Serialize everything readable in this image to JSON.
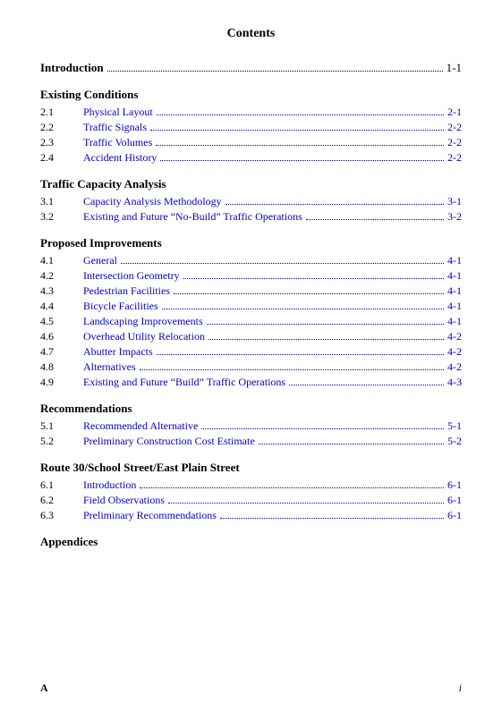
{
  "page": {
    "title": "Contents",
    "footer": {
      "left": "A",
      "right": "i"
    }
  },
  "intro": {
    "label": "Introduction",
    "page": "1-1"
  },
  "sections": [
    {
      "heading": "Existing Conditions",
      "entries": [
        {
          "number": "2.1",
          "label": "Physical Layout",
          "page": "2-1"
        },
        {
          "number": "2.2",
          "label": "Traffic Signals",
          "page": "2-2"
        },
        {
          "number": "2.3",
          "label": "Traffic Volumes",
          "page": "2-2"
        },
        {
          "number": "2.4",
          "label": "Accident History",
          "page": "2-2"
        }
      ]
    },
    {
      "heading": "Traffic Capacity Analysis",
      "entries": [
        {
          "number": "3.1",
          "label": "Capacity Analysis Methodology",
          "page": "3-1"
        },
        {
          "number": "3.2",
          "label": "Existing and Future “No-Build” Traffic Operations",
          "page": "3-2"
        }
      ]
    },
    {
      "heading": "Proposed Improvements",
      "entries": [
        {
          "number": "4.1",
          "label": "General",
          "page": "4-1"
        },
        {
          "number": "4.2",
          "label": "Intersection Geometry",
          "page": "4-1"
        },
        {
          "number": "4.3",
          "label": "Pedestrian Facilities",
          "page": "4-1"
        },
        {
          "number": "4.4",
          "label": "Bicycle Facilities",
          "page": "4-1"
        },
        {
          "number": "4.5",
          "label": "Landscaping Improvements",
          "page": "4-1"
        },
        {
          "number": "4.6",
          "label": "Overhead Utility Relocation",
          "page": "4-2"
        },
        {
          "number": "4.7",
          "label": "Abutter Impacts",
          "page": "4-2"
        },
        {
          "number": "4.8",
          "label": "Alternatives",
          "page": "4-2"
        },
        {
          "number": "4.9",
          "label": "Existing and Future “Build” Traffic Operations",
          "page": "4-3"
        }
      ]
    },
    {
      "heading": "Recommendations",
      "entries": [
        {
          "number": "5.1",
          "label": "Recommended Alternative",
          "page": "5-1"
        },
        {
          "number": "5.2",
          "label": "Preliminary Construction Cost Estimate",
          "page": "5-2"
        }
      ]
    },
    {
      "heading": "Route 30/School Street/East Plain Street",
      "entries": [
        {
          "number": "6.1",
          "label": "Introduction",
          "page": "6-1"
        },
        {
          "number": "6.2",
          "label": "Field Observations",
          "page": "6-1"
        },
        {
          "number": "6.3",
          "label": "Preliminary Recommendations",
          "page": "6-1"
        }
      ]
    },
    {
      "heading": "Appendices",
      "entries": []
    }
  ]
}
